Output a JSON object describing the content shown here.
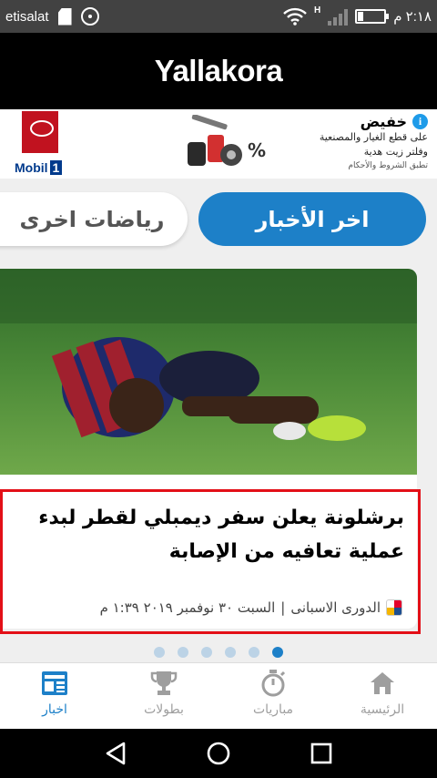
{
  "status_bar": {
    "carrier": "etisalat",
    "time": "٢:١٨ م",
    "network_label": "H",
    "icons": [
      "sd-card-icon",
      "cast-icon",
      "wifi-icon",
      "signal-icon",
      "battery-icon"
    ]
  },
  "app": {
    "logo": "Yallakora"
  },
  "ad": {
    "title": "خفيض",
    "line1": "على قطع الغيار والمصنعية",
    "line2": "وفلتر زيت هدية",
    "note": "تطبق الشروط والأحكام",
    "brand": "Mobil",
    "brand_badge": "1",
    "info_label": "i"
  },
  "tabs": [
    {
      "label": "اخر الأخبار",
      "active": true
    },
    {
      "label": "رياضات اخرى",
      "active": false
    }
  ],
  "article": {
    "headline": "برشلونة يعلن سفر ديمبلي لقطر لبدء عملية تعافيه من الإصابة",
    "league": "الدورى الاسبانى",
    "separator": "|",
    "date": "السبت ٣٠ نوفمبر ٢٠١٩ ١:٣٩ م"
  },
  "pager": {
    "count": 6,
    "active_index": 5
  },
  "bottom_nav": [
    {
      "label": "الرئيسية",
      "icon": "home-icon",
      "active": false
    },
    {
      "label": "مباريات",
      "icon": "stopwatch-icon",
      "active": false
    },
    {
      "label": "بطولات",
      "icon": "trophy-icon",
      "active": false
    },
    {
      "label": "اخبار",
      "icon": "news-icon",
      "active": true
    }
  ],
  "colors": {
    "accent": "#1d80c8",
    "highlight": "#e30f17",
    "appbar": "#000000",
    "statusbar": "#424242"
  }
}
